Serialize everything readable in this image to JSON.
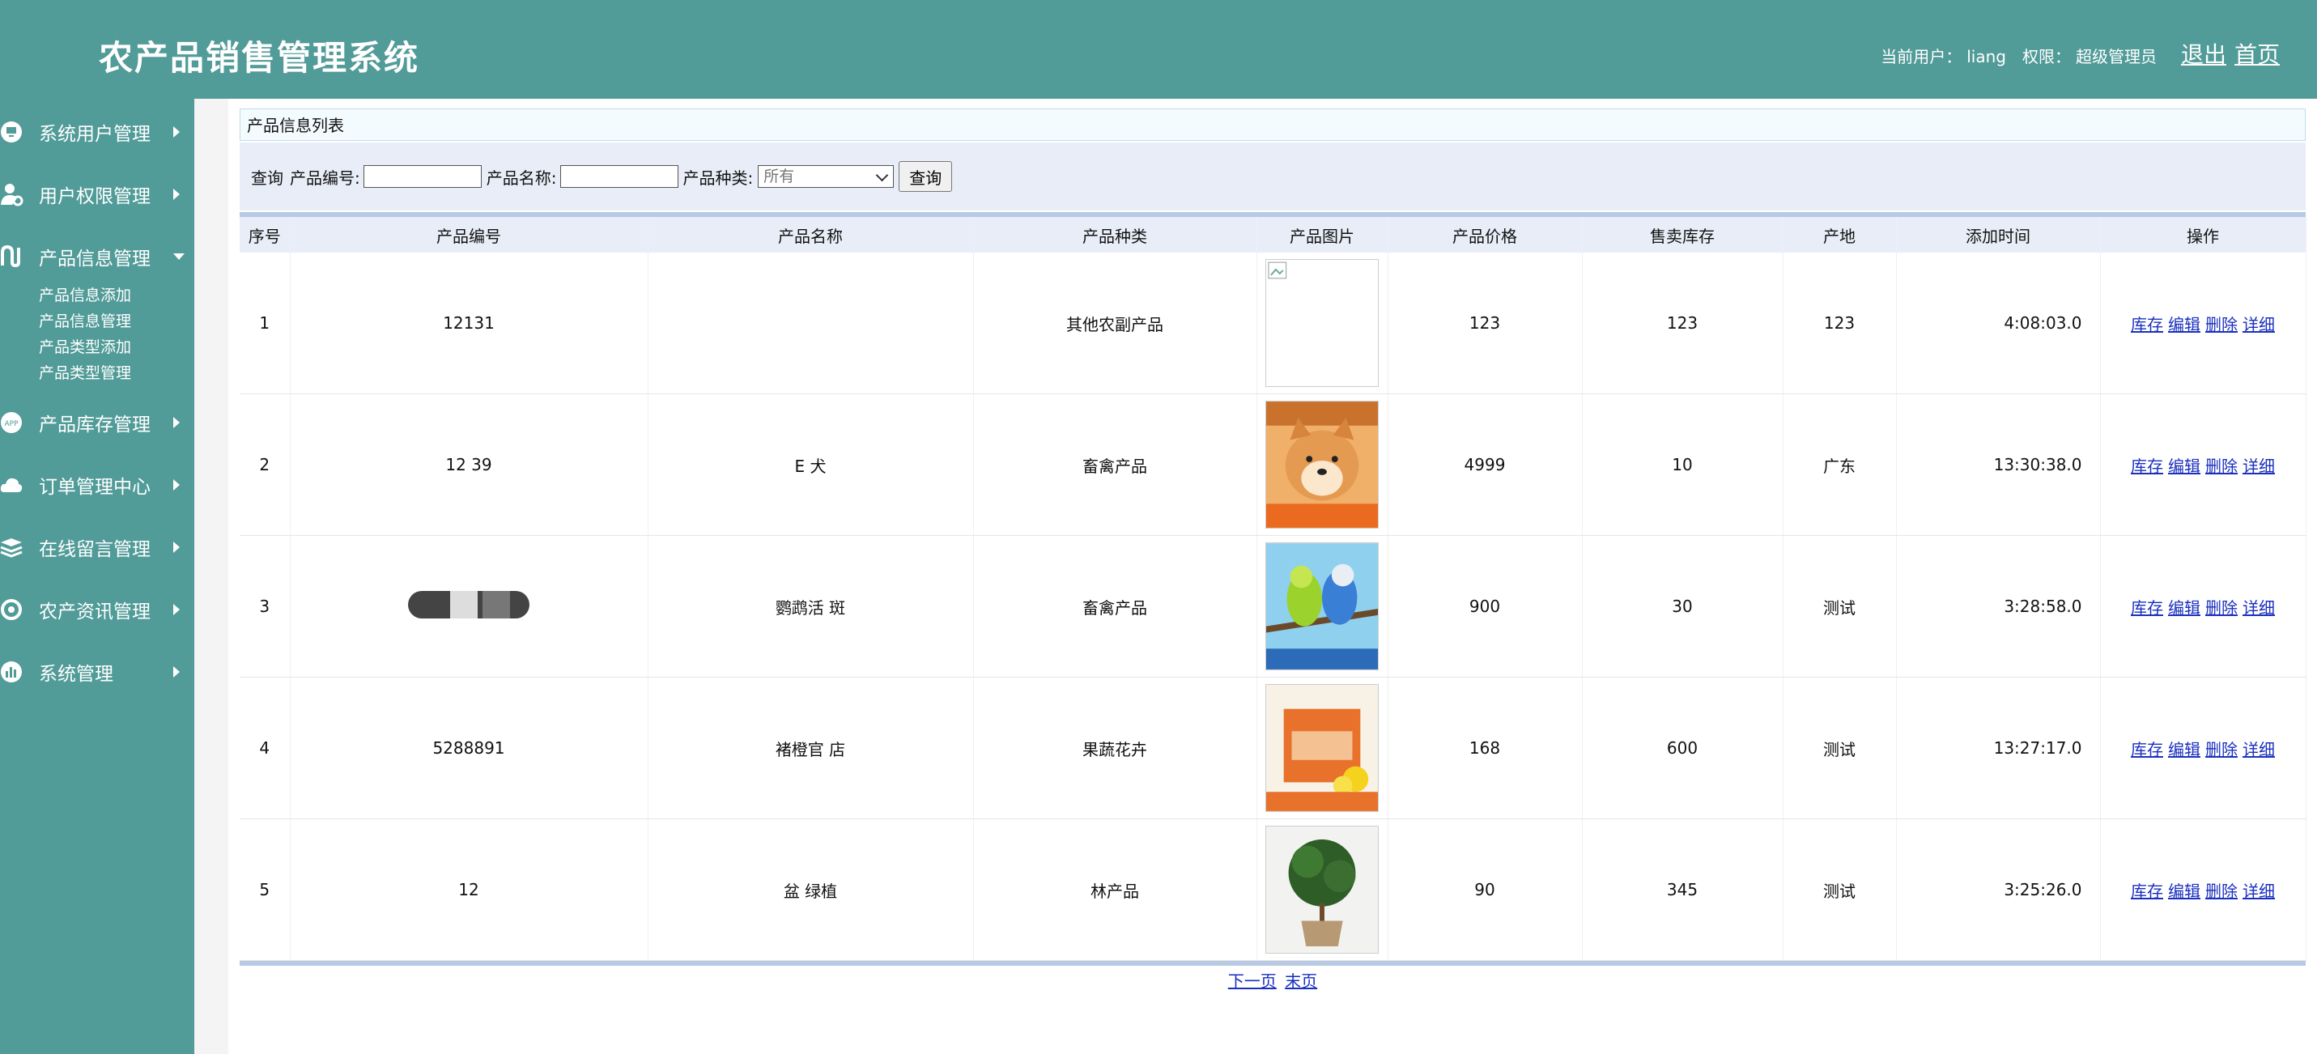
{
  "header": {
    "app_title": "农产品销售管理系统",
    "current_user_label": "当前用户：",
    "current_user": "liang",
    "role_label": "权限：",
    "role": "超级管理员",
    "logout": "退出",
    "home": "首页"
  },
  "sidebar": {
    "items": [
      {
        "label": "系统用户管理",
        "icon": "monitor-icon"
      },
      {
        "label": "用户权限管理",
        "icon": "user-gear-icon"
      },
      {
        "label": "产品信息管理",
        "icon": "magnet-icon",
        "expanded": true,
        "children": [
          "产品信息添加",
          "产品信息管理",
          "产品类型添加",
          "产品类型管理"
        ]
      },
      {
        "label": "产品库存管理",
        "icon": "app-badge-icon"
      },
      {
        "label": "订单管理中心",
        "icon": "cloud-icon"
      },
      {
        "label": "在线留言管理",
        "icon": "layers-icon"
      },
      {
        "label": "农产资讯管理",
        "icon": "settings-icon"
      },
      {
        "label": "系统管理",
        "icon": "chart-icon"
      }
    ]
  },
  "panel_title": "产品信息列表",
  "search": {
    "prefix": "查询",
    "code_label": "产品编号:",
    "name_label": "产品名称:",
    "type_label": "产品种类:",
    "type_selected": "所有",
    "button": "查询"
  },
  "table": {
    "headers": [
      "序号",
      "产品编号",
      "产品名称",
      "产品种类",
      "产品图片",
      "产品价格",
      "售卖库存",
      "产地",
      "添加时间",
      "操作"
    ],
    "rows": [
      {
        "no": "1",
        "code": "12131",
        "name": "",
        "type": "其他农副产品",
        "image": "broken-image",
        "price": "123",
        "stock": "123",
        "origin": "123",
        "time": "4:08:03.0"
      },
      {
        "no": "2",
        "code": "12 39",
        "name": "E 犬",
        "type": "畜禽产品",
        "image": "shiba-dog",
        "price": "4999",
        "stock": "10",
        "origin": "广东",
        "time": "13:30:38.0"
      },
      {
        "no": "3",
        "code": "",
        "name": "鹦鹉活 斑",
        "type": "畜禽产品",
        "image": "parrots",
        "price": "900",
        "stock": "30",
        "origin": "测试",
        "time": "3:28:58.0"
      },
      {
        "no": "4",
        "code": "5288891",
        "name": "褚橙官 店",
        "type": "果蔬花卉",
        "image": "orange-box",
        "price": "168",
        "stock": "600",
        "origin": "测试",
        "time": "13:27:17.0"
      },
      {
        "no": "5",
        "code": "12",
        "name": "盆 绿植",
        "type": "林产品",
        "image": "potted-tree",
        "price": "90",
        "stock": "345",
        "origin": "测试",
        "time": "3:25:26.0"
      }
    ],
    "ops": [
      "库存",
      "编辑",
      "删除",
      "详细"
    ]
  },
  "pager": {
    "next": "下一页",
    "last": "末页"
  },
  "colors": {
    "theme": "#519b98",
    "link": "#1a2fbf",
    "header_row": "#e8edf7"
  }
}
